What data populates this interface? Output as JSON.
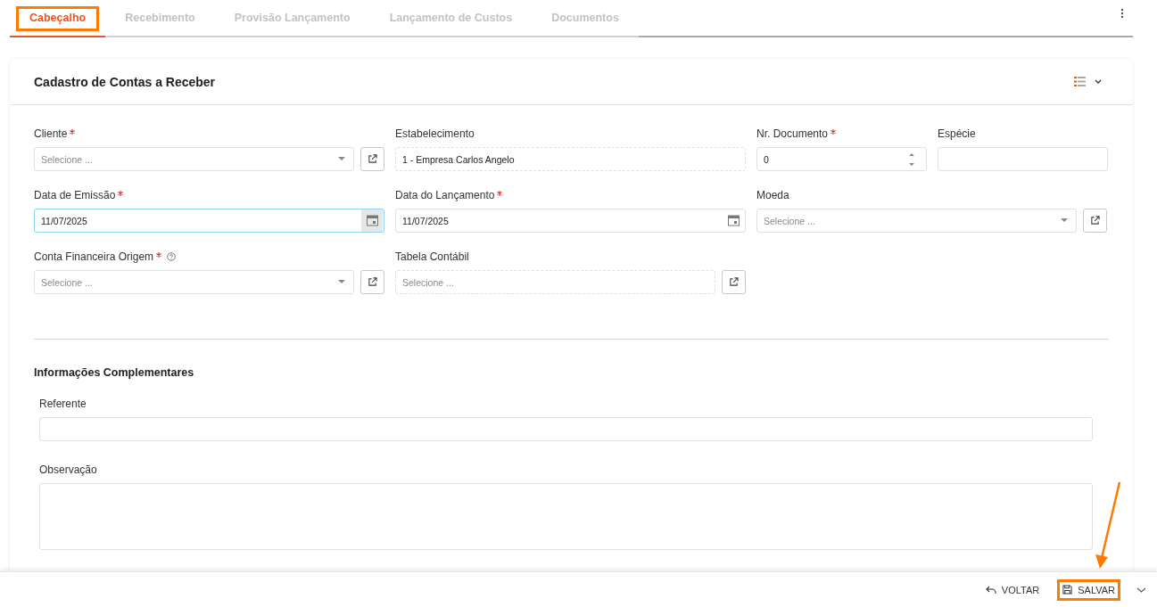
{
  "tabs": [
    {
      "label": "Cabeçalho",
      "selected": true,
      "highlighted": true
    },
    {
      "label": "Recebimento",
      "selected": false,
      "highlighted": false
    },
    {
      "label": "Provisão Lançamento",
      "selected": false,
      "highlighted": false
    },
    {
      "label": "Lançamento de Custos",
      "selected": false,
      "highlighted": false
    },
    {
      "label": "Documentos",
      "selected": false,
      "highlighted": false
    }
  ],
  "card": {
    "title": "Cadastro de Contas a Receber"
  },
  "rows": [
    [
      {
        "kind": "select",
        "label": "Cliente",
        "required": true,
        "help": false,
        "placeholder": "Selecione ...",
        "link": true
      },
      {
        "kind": "readonly",
        "label": "Estabelecimento",
        "required": false,
        "help": false,
        "value": "1 - Empresa Carlos Angelo",
        "link": false
      },
      {
        "kind": "number",
        "label": "Nr. Documento",
        "required": true,
        "help": false,
        "value": "0",
        "link": false
      },
      {
        "kind": "text",
        "label": "Espécie",
        "required": false,
        "help": false,
        "link": false
      }
    ],
    [
      {
        "kind": "date",
        "label": "Data de Emissão",
        "required": true,
        "help": false,
        "value": "11/07/2025",
        "focused": true,
        "link": false
      },
      {
        "kind": "date",
        "label": "Data do Lançamento",
        "required": true,
        "help": false,
        "value": "11/07/2025",
        "focused": false,
        "link": false
      },
      {
        "kind": "select",
        "label": "Moeda",
        "required": false,
        "help": false,
        "placeholder": "Selecione ...",
        "link": true
      }
    ],
    [
      {
        "kind": "select",
        "label": "Conta Financeira Origem",
        "required": true,
        "help": true,
        "placeholder": "Selecione ...",
        "link": true
      },
      {
        "kind": "readonly",
        "label": "Tabela Contábil",
        "required": false,
        "help": false,
        "placeholder": "Selecione ...",
        "link": true
      }
    ]
  ],
  "complementary": {
    "title": "Informações Complementares",
    "fields": [
      {
        "kind": "text",
        "label": "Referente"
      },
      {
        "kind": "textarea",
        "label": "Observação"
      }
    ]
  },
  "footer": {
    "buttons": [
      {
        "kind": "back",
        "label": "VOLTAR",
        "highlighted": false
      },
      {
        "kind": "save",
        "label": "SALVAR",
        "highlighted": true
      }
    ],
    "arrow_annotation": true
  }
}
